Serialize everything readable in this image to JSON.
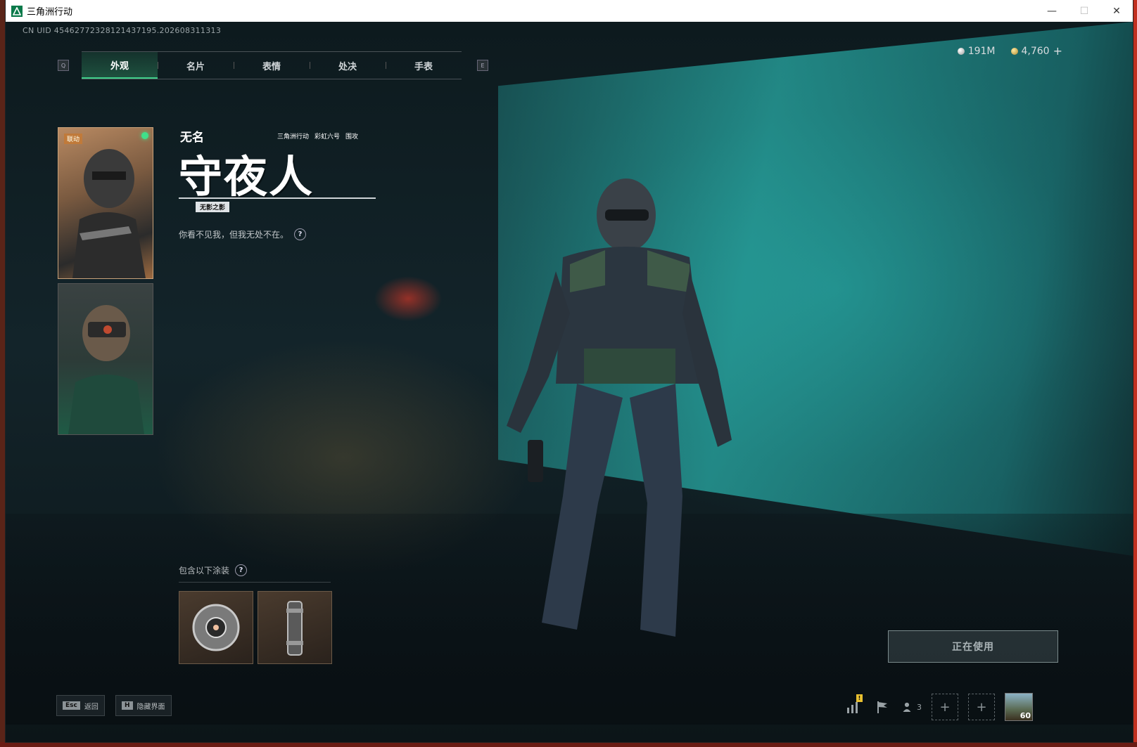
{
  "window": {
    "title": "三角洲行动",
    "minimize": "—",
    "maximize": "☐",
    "close": "✕"
  },
  "uid": "CN UID 4546277232812143719​5.202608311313",
  "tabs": {
    "left_key": "Q",
    "right_key": "E",
    "items": [
      {
        "label": "外观",
        "active": true
      },
      {
        "label": "名片",
        "active": false
      },
      {
        "label": "表情",
        "active": false
      },
      {
        "label": "处决",
        "active": false
      },
      {
        "label": "手表",
        "active": false
      }
    ]
  },
  "currency": {
    "silver": "191M",
    "gold": "4,760",
    "add": "+"
  },
  "portraits": {
    "first_badge": "联动"
  },
  "skin": {
    "operator": "无名",
    "name": "守夜人",
    "brand_game": "三角洲行动",
    "brand_collab": "彩虹六号",
    "brand_extra": "围攻",
    "tag": "无影之影",
    "description": "你看不见我，但我无处不在。",
    "help": "?"
  },
  "includes": {
    "label": "包含以下涂装",
    "help": "?"
  },
  "actions": {
    "in_use": "正在使用"
  },
  "bottom": {
    "esc_key": "Esc",
    "esc_label": "返回",
    "hide_key": "H",
    "hide_label": "隐藏界面",
    "warn": "!",
    "friends_count": "3",
    "slot_plus": "+",
    "level": "60"
  },
  "colors": {
    "accent_green": "#3fd08a",
    "teal_screen": "#28aaa5"
  },
  "icons": [
    "app-icon",
    "silver-coin-icon",
    "gold-coin-icon",
    "help-icon",
    "stats-icon",
    "flag-icon",
    "friends-icon",
    "plus-icon"
  ]
}
